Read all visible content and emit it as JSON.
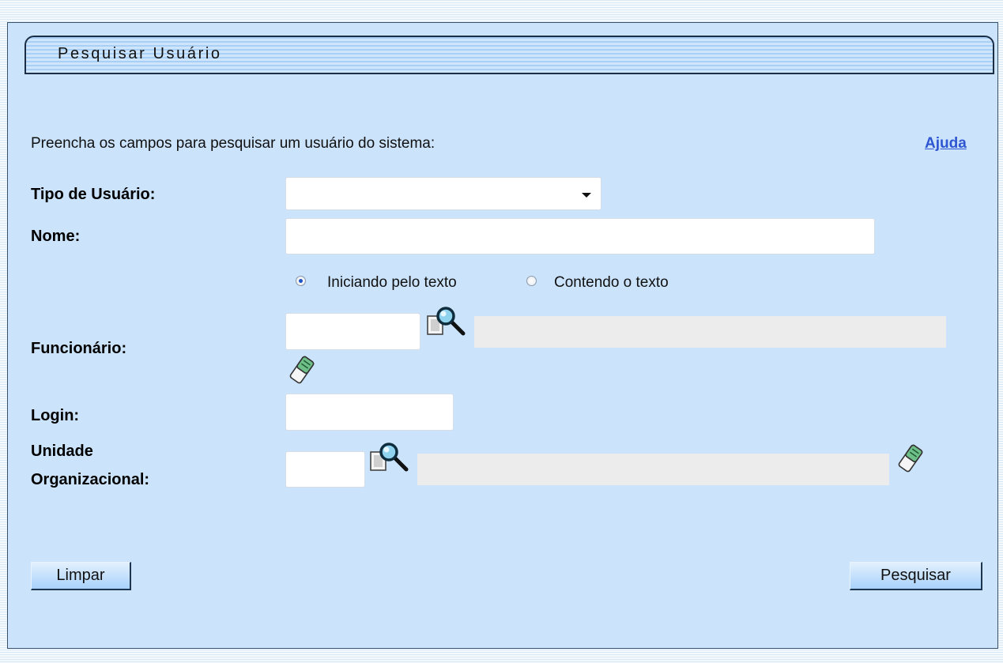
{
  "title": "Pesquisar Usuário",
  "intro": "Preencha os campos para pesquisar um usuário do sistema:",
  "help_link": "Ajuda",
  "form": {
    "tipo_usuario": {
      "label": "Tipo de Usuário:",
      "value": ""
    },
    "nome": {
      "label": "Nome:",
      "value": "",
      "radio_starts": "Iniciando pelo texto",
      "radio_contains": "Contendo o texto",
      "selected": "Iniciando pelo texto"
    },
    "funcionario": {
      "label": "Funcionário:",
      "code": "",
      "description": ""
    },
    "login": {
      "label": "Login:",
      "value": ""
    },
    "unidade": {
      "label_line1": "Unidade",
      "label_line2": "Organizacional:",
      "code": "",
      "description": ""
    }
  },
  "buttons": {
    "clear": "Limpar",
    "search": "Pesquisar"
  },
  "icons": [
    "search-magnifier-icon",
    "eraser-icon"
  ]
}
